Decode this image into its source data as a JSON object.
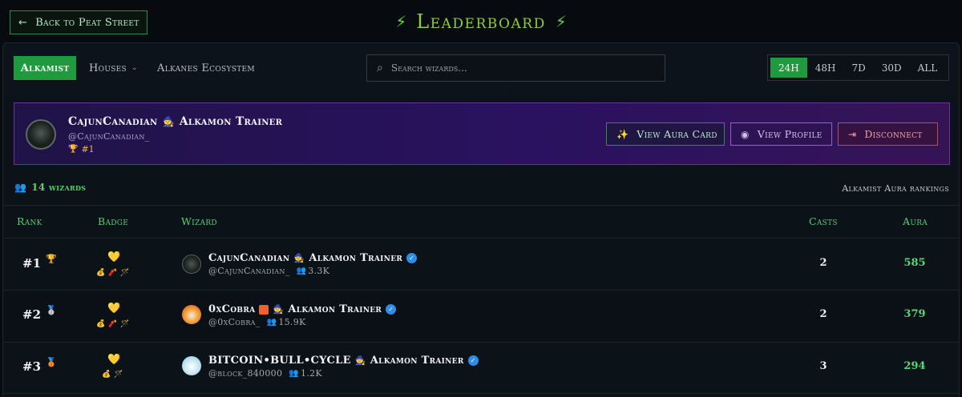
{
  "header": {
    "back_label": "Back to Peat Street",
    "title": "Leaderboard"
  },
  "nav": {
    "alkamist": "Alkamist",
    "houses": "Houses",
    "ecosystem": "Alkanes Ecosystem"
  },
  "search": {
    "placeholder": "Search wizards..."
  },
  "time_ranges": [
    {
      "label": "24H",
      "active": true
    },
    {
      "label": "48H",
      "active": false
    },
    {
      "label": "7D",
      "active": false
    },
    {
      "label": "30D",
      "active": false
    },
    {
      "label": "ALL",
      "active": false
    }
  ],
  "profile": {
    "name": "CajunCanadian",
    "role": "Alkamon Trainer",
    "handle": "@CajunCanadian_",
    "rank": "#1",
    "view_aura_card": "View Aura Card",
    "view_profile": "View Profile",
    "disconnect": "Disconnect"
  },
  "summary": {
    "wizard_count": "14 wizards",
    "caption": "Alkamist Aura rankings"
  },
  "table": {
    "headers": {
      "rank": "Rank",
      "badge": "Badge",
      "wizard": "Wizard",
      "casts": "Casts",
      "aura": "Aura"
    },
    "rows": [
      {
        "rank": "#1",
        "name": "CajunCanadian",
        "role": "Alkamon Trainer",
        "handle": "@CajunCanadian_",
        "followers": "3.3K",
        "casts": "2",
        "aura": "585"
      },
      {
        "rank": "#2",
        "name": "0xCobra",
        "role": "Alkamon Trainer",
        "handle": "@0xCobra_",
        "followers": "15.9K",
        "casts": "2",
        "aura": "379"
      },
      {
        "rank": "#3",
        "name": "BITCOIN•BULL•CYCLE",
        "role": "Alkamon Trainer",
        "handle": "@block_840000",
        "followers": "1.2K",
        "casts": "3",
        "aura": "294"
      }
    ]
  },
  "colors": {
    "accent_green": "#1f9a3f",
    "aura_green": "#58d67a",
    "profile_purple": "#2a1260",
    "disconnect_red": "#bb4d51",
    "title_green": "#8ccf3a"
  },
  "icons": {
    "back": "arrow-left-icon",
    "title": "lightning-bolt-icon",
    "search": "search-icon",
    "aura_card": "sparkles-icon",
    "profile": "eye-icon",
    "disconnect": "logout-icon",
    "wizards": "users-icon",
    "verified": "verified-check-icon"
  }
}
